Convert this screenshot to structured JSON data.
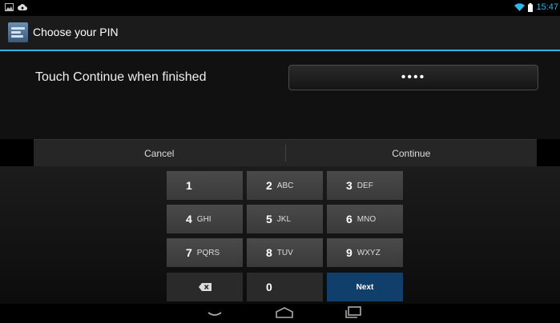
{
  "status_bar": {
    "time": "15:47"
  },
  "action_bar": {
    "title": "Choose your PIN"
  },
  "content": {
    "prompt": "Touch Continue when finished",
    "pin_value": "••••"
  },
  "buttons": {
    "cancel": "Cancel",
    "continue": "Continue"
  },
  "keypad": {
    "keys": [
      {
        "digit": "1",
        "letters": ""
      },
      {
        "digit": "2",
        "letters": "ABC"
      },
      {
        "digit": "3",
        "letters": "DEF"
      },
      {
        "digit": "4",
        "letters": "GHI"
      },
      {
        "digit": "5",
        "letters": "JKL"
      },
      {
        "digit": "6",
        "letters": "MNO"
      },
      {
        "digit": "7",
        "letters": "PQRS"
      },
      {
        "digit": "8",
        "letters": "TUV"
      },
      {
        "digit": "9",
        "letters": "WXYZ"
      }
    ],
    "zero": "0",
    "next": "Next"
  },
  "icons": {
    "status_left": [
      "image-icon",
      "cloud-upload-icon"
    ],
    "status_right": [
      "wifi-icon",
      "battery-icon"
    ],
    "nav": [
      "back-icon",
      "home-icon",
      "recents-icon"
    ],
    "keypad": [
      "backspace-icon"
    ]
  },
  "colors": {
    "accent": "#33b5e5",
    "next_key": "#0f3f6a"
  }
}
